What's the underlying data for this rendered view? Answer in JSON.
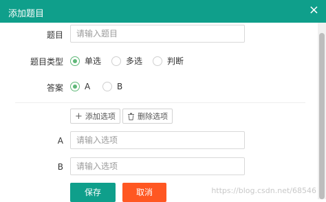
{
  "dialog": {
    "title": "添加题目",
    "close_glyph": "×"
  },
  "form": {
    "question": {
      "label": "题目",
      "placeholder": "请输入题目",
      "value": ""
    },
    "type": {
      "label": "题目类型",
      "options": [
        {
          "label": "单选",
          "checked": true
        },
        {
          "label": "多选",
          "checked": false
        },
        {
          "label": "判断",
          "checked": false
        }
      ]
    },
    "answer": {
      "label": "答案",
      "options": [
        {
          "label": "A",
          "checked": true
        },
        {
          "label": "B",
          "checked": false
        }
      ]
    },
    "add_option_label": "添加选项",
    "delete_option_label": "删除选项",
    "options": [
      {
        "label": "A",
        "placeholder": "请输入选项",
        "value": ""
      },
      {
        "label": "B",
        "placeholder": "请输入选项",
        "value": ""
      }
    ]
  },
  "actions": {
    "save_label": "保存",
    "cancel_label": "取消"
  },
  "watermark": "https://blog.csdn.net/68546",
  "colors": {
    "primary": "#0f9f8b",
    "danger": "#ff5722",
    "radio": "#5fb878"
  }
}
